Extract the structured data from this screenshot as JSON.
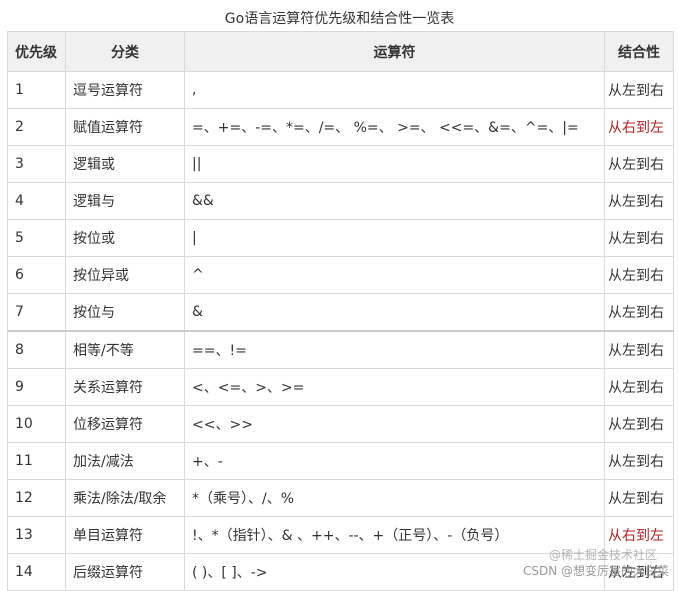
{
  "caption": "Go语言运算符优先级和结合性一览表",
  "headers": {
    "priority": "优先级",
    "category": "分类",
    "operators": "运算符",
    "associativity": "结合性"
  },
  "rows": [
    {
      "priority": "1",
      "category": "逗号运算符",
      "operators": ",",
      "associativity": "从左到右"
    },
    {
      "priority": "2",
      "category": "赋值运算符",
      "operators": "=、+=、-=、*=、/=、 %=、 >=、 <<=、&=、^=、|=",
      "associativity": "从右到左"
    },
    {
      "priority": "3",
      "category": "逻辑或",
      "operators": "||",
      "associativity": "从左到右"
    },
    {
      "priority": "4",
      "category": "逻辑与",
      "operators": "&&",
      "associativity": "从左到右"
    },
    {
      "priority": "5",
      "category": "按位或",
      "operators": "|",
      "associativity": "从左到右"
    },
    {
      "priority": "6",
      "category": "按位异或",
      "operators": "^",
      "associativity": "从左到右"
    },
    {
      "priority": "7",
      "category": "按位与",
      "operators": "&",
      "associativity": "从左到右"
    },
    {
      "priority": "8",
      "category": "相等/不等",
      "operators": "==、!=",
      "associativity": "从左到右"
    },
    {
      "priority": "9",
      "category": "关系运算符",
      "operators": "<、<=、>、>=",
      "associativity": "从左到右"
    },
    {
      "priority": "10",
      "category": "位移运算符",
      "operators": "<<、>>",
      "associativity": "从左到右"
    },
    {
      "priority": "11",
      "category": "加法/减法",
      "operators": "+、-",
      "associativity": "从左到右"
    },
    {
      "priority": "12",
      "category": "乘法/除法/取余",
      "operators": "*（乘号）、/、%",
      "associativity": "从左到右"
    },
    {
      "priority": "13",
      "category": "单目运算符",
      "operators": "!、*（指针）、& 、++、--、+（正号）、-（负号）",
      "associativity": "从右到左"
    },
    {
      "priority": "14",
      "category": "后缀运算符",
      "operators": "( )、[ ]、->",
      "associativity": "从左到右"
    }
  ],
  "colors": {
    "header_bg": "#f0f0f0",
    "border": "#d9d9d9",
    "text": "#333333",
    "rtl_text": "#b22222"
  },
  "watermark": {
    "ghost": "@稀土掘金技术社区",
    "main": "CSDN @想变厉害的大白菜"
  }
}
